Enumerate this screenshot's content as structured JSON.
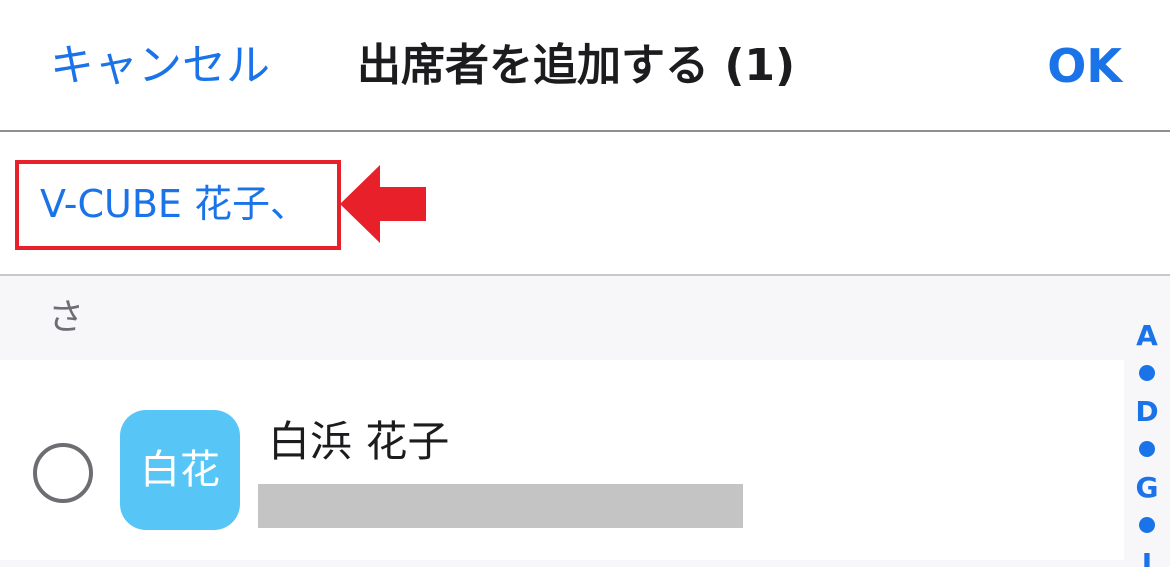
{
  "navbar": {
    "cancel_label": "キャンセル",
    "title": "出席者を追加する (1)",
    "ok_label": "OK"
  },
  "selected": {
    "chip_text": "V-CUBE 花子、"
  },
  "list": {
    "section_header": "さ",
    "contacts": [
      {
        "name": "白浜 花子",
        "avatar_text": "白花",
        "selected": false
      }
    ]
  },
  "alpha_index": {
    "letters": [
      "A",
      "D",
      "G",
      "J"
    ]
  },
  "colors": {
    "accent": "#1a73e8",
    "highlight_red": "#e8202a",
    "avatar_bg": "#57c6f7",
    "separator": "#8e8e93",
    "section_bg": "#f7f7fa"
  }
}
